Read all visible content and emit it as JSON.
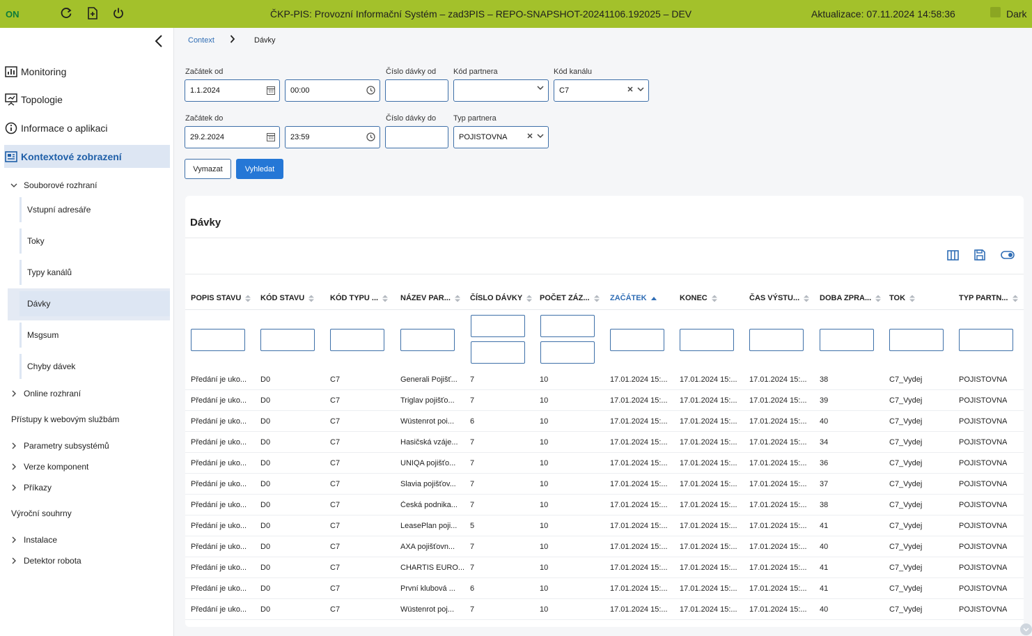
{
  "topbar": {
    "status": "ON",
    "title": "ČKP-PIS: Provozní Informační Systém – zad3PIS – REPO-SNAPSHOT-20241106.192025 – DEV",
    "update": "Aktualizace: 07.11.2024 14:58:36",
    "dark_label": "Dark",
    "icons": [
      "refresh-icon",
      "file-plus-icon",
      "power-icon"
    ]
  },
  "sidebar": {
    "main": [
      {
        "label": "Monitoring",
        "icon": "bar-chart-icon"
      },
      {
        "label": "Topologie",
        "icon": "presentation-icon"
      },
      {
        "label": "Informace o aplikaci",
        "icon": "info-icon"
      },
      {
        "label": "Kontextové zobrazení",
        "icon": "newspaper-icon"
      }
    ],
    "group_file": "Souborové rozhraní",
    "sub": [
      "Vstupní adresáře",
      "Toky",
      "Typy kanálů",
      "Dávky",
      "Msgsum",
      "Chyby dávek"
    ],
    "group_online": "Online rozhraní",
    "plain_ws": "Přístupy k webovým službám",
    "group_params": "Parametry subsystémů",
    "group_versions": "Verze komponent",
    "group_commands": "Příkazy",
    "plain_annual": "Výroční souhrny",
    "group_install": "Instalace",
    "group_robot": "Detektor robota"
  },
  "breadcrumb": {
    "context": "Context",
    "current": "Dávky"
  },
  "filters": {
    "start_from_label": "Začátek od",
    "start_from_date": "1.1.2024",
    "start_from_time": "00:00",
    "batch_from_label": "Číslo dávky od",
    "batch_from_value": "",
    "partner_code_label": "Kód partnera",
    "partner_code_value": "",
    "channel_code_label": "Kód kanálu",
    "channel_code_value": "C7",
    "start_to_label": "Začátek do",
    "start_to_date": "29.2.2024",
    "start_to_time": "23:59",
    "batch_to_label": "Číslo dávky do",
    "batch_to_value": "",
    "partner_type_label": "Typ partnera",
    "partner_type_value": "POJISTOVNA",
    "clear_label": "Vymazat",
    "search_label": "Vyhledat"
  },
  "table": {
    "title": "Dávky",
    "columns": [
      "POPIS STAVU",
      "KÓD STAVU",
      "KÓD TYPU ...",
      "NÁZEV PAR...",
      "ČÍSLO DÁVKY",
      "POČET ZÁZ...",
      "ZAČÁTEK",
      "KONEC",
      "ČAS VÝSTU...",
      "DOBA ZPRA...",
      "TOK",
      "TYP PARTN..."
    ],
    "sorted_column": "ZAČÁTEK",
    "rows": [
      [
        "Předání je uko...",
        "D0",
        "C7",
        "Generali Pojišť...",
        "7",
        "10",
        "17.01.2024 15:...",
        "17.01.2024 15:...",
        "17.01.2024 15:...",
        "38",
        "C7_Vydej",
        "POJISTOVNA"
      ],
      [
        "Předání je uko...",
        "D0",
        "C7",
        "Triglav pojišťo...",
        "7",
        "10",
        "17.01.2024 15:...",
        "17.01.2024 15:...",
        "17.01.2024 15:...",
        "39",
        "C7_Vydej",
        "POJISTOVNA"
      ],
      [
        "Předání je uko...",
        "D0",
        "C7",
        "Wüstenrot poi...",
        "6",
        "10",
        "17.01.2024 15:...",
        "17.01.2024 15:...",
        "17.01.2024 15:...",
        "40",
        "C7_Vydej",
        "POJISTOVNA"
      ],
      [
        "Předání je uko...",
        "D0",
        "C7",
        "Hasičská vzáje...",
        "7",
        "10",
        "17.01.2024 15:...",
        "17.01.2024 15:...",
        "17.01.2024 15:...",
        "34",
        "C7_Vydej",
        "POJISTOVNA"
      ],
      [
        "Předání je uko...",
        "D0",
        "C7",
        "UNIQA pojišťo...",
        "7",
        "10",
        "17.01.2024 15:...",
        "17.01.2024 15:...",
        "17.01.2024 15:...",
        "36",
        "C7_Vydej",
        "POJISTOVNA"
      ],
      [
        "Předání je uko...",
        "D0",
        "C7",
        "Slavia pojišťov...",
        "7",
        "10",
        "17.01.2024 15:...",
        "17.01.2024 15:...",
        "17.01.2024 15:...",
        "37",
        "C7_Vydej",
        "POJISTOVNA"
      ],
      [
        "Předání je uko...",
        "D0",
        "C7",
        "Česká podnika...",
        "7",
        "10",
        "17.01.2024 15:...",
        "17.01.2024 15:...",
        "17.01.2024 15:...",
        "38",
        "C7_Vydej",
        "POJISTOVNA"
      ],
      [
        "Předání je uko...",
        "D0",
        "C7",
        "LeasePlan poji...",
        "5",
        "10",
        "17.01.2024 15:...",
        "17.01.2024 15:...",
        "17.01.2024 15:...",
        "41",
        "C7_Vydej",
        "POJISTOVNA"
      ],
      [
        "Předání je uko...",
        "D0",
        "C7",
        "AXA pojišťovn...",
        "7",
        "10",
        "17.01.2024 15:...",
        "17.01.2024 15:...",
        "17.01.2024 15:...",
        "40",
        "C7_Vydej",
        "POJISTOVNA"
      ],
      [
        "Předání je uko...",
        "D0",
        "C7",
        "CHARTIS EURO...",
        "7",
        "10",
        "17.01.2024 15:...",
        "17.01.2024 15:...",
        "17.01.2024 15:...",
        "41",
        "C7_Vydej",
        "POJISTOVNA"
      ],
      [
        "Předání je uko...",
        "D0",
        "C7",
        "První klubová ...",
        "6",
        "10",
        "17.01.2024 15:...",
        "17.01.2024 15:...",
        "17.01.2024 15:...",
        "41",
        "C7_Vydej",
        "POJISTOVNA"
      ],
      [
        "Předání je uko...",
        "D0",
        "C7",
        "Wüstenrot poj...",
        "7",
        "10",
        "17.01.2024 15:...",
        "17.01.2024 15:...",
        "17.01.2024 15:...",
        "40",
        "C7_Vydej",
        "POJISTOVNA"
      ]
    ],
    "tools": [
      "columns-icon",
      "save-icon",
      "toggle-icon"
    ]
  },
  "colors": {
    "topbar": "#a3c12b",
    "accent": "#2577d6",
    "active_bg": "#dde6f3",
    "link": "#2f6db5"
  }
}
